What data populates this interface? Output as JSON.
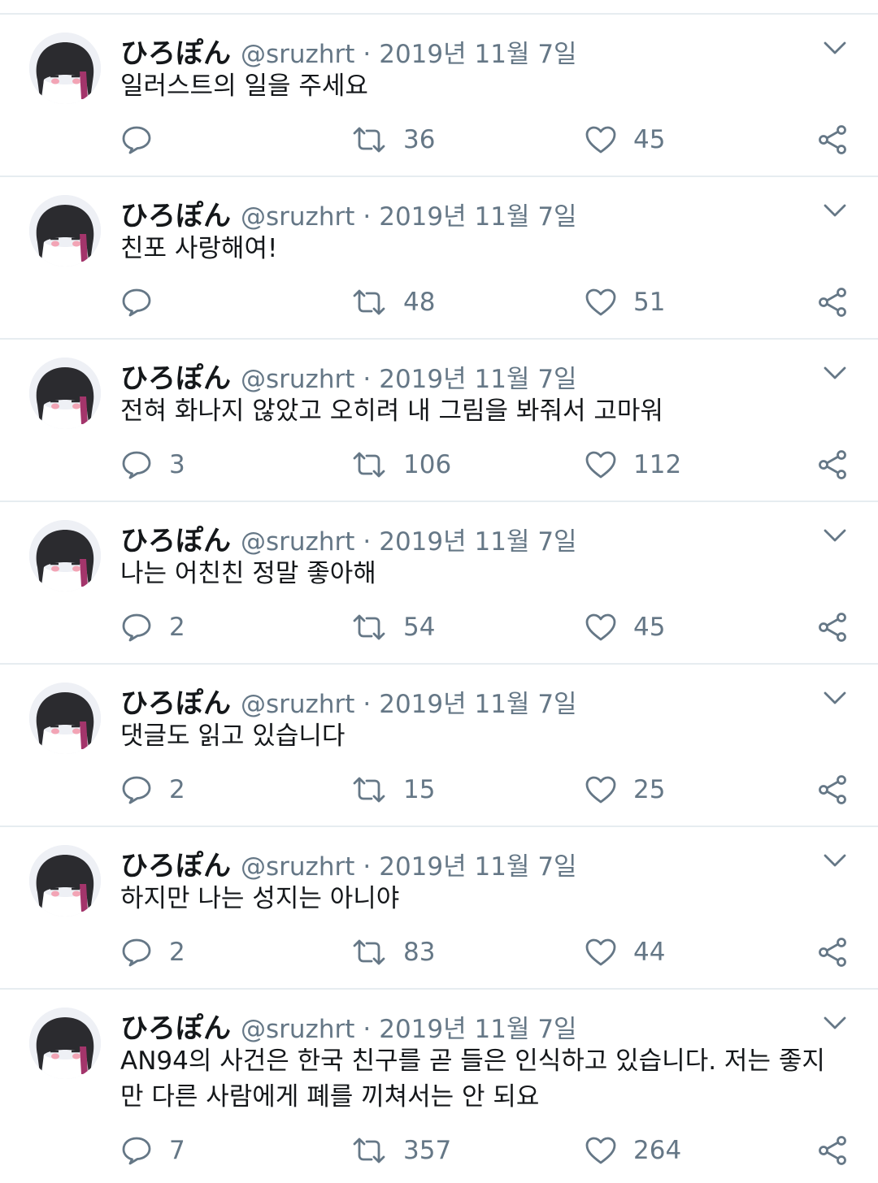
{
  "tweets": [
    {
      "name": "ひろぽん",
      "handle": "@sruzhrt",
      "sep": "·",
      "date": "2019년 11월 7일",
      "text": "일러스트의 일을 주세요",
      "replies": "",
      "retweets": "36",
      "likes": "45"
    },
    {
      "name": "ひろぽん",
      "handle": "@sruzhrt",
      "sep": "·",
      "date": "2019년 11월 7일",
      "text": "친포 사랑해여!",
      "replies": "",
      "retweets": "48",
      "likes": "51"
    },
    {
      "name": "ひろぽん",
      "handle": "@sruzhrt",
      "sep": "·",
      "date": "2019년 11월 7일",
      "text": "전혀 화나지 않았고 오히려 내 그림을 봐줘서 고마워",
      "replies": "3",
      "retweets": "106",
      "likes": "112"
    },
    {
      "name": "ひろぽん",
      "handle": "@sruzhrt",
      "sep": "·",
      "date": "2019년 11월 7일",
      "text": "나는 어친친 정말 좋아해",
      "replies": "2",
      "retweets": "54",
      "likes": "45"
    },
    {
      "name": "ひろぽん",
      "handle": "@sruzhrt",
      "sep": "·",
      "date": "2019년 11월 7일",
      "text": "댓글도 읽고 있습니다",
      "replies": "2",
      "retweets": "15",
      "likes": "25"
    },
    {
      "name": "ひろぽん",
      "handle": "@sruzhrt",
      "sep": "·",
      "date": "2019년 11월 7일",
      "text": "하지만 나는 성지는 아니야",
      "replies": "2",
      "retweets": "83",
      "likes": "44"
    },
    {
      "name": "ひろぽん",
      "handle": "@sruzhrt",
      "sep": "·",
      "date": "2019년 11월 7일",
      "text": "AN94의 사건은 한국 친구를 곧 들은 인식하고 있습니다. 저는 좋지만 다른 사람에게 폐를 끼쳐서는 안 되요",
      "replies": "7",
      "retweets": "357",
      "likes": "264"
    }
  ],
  "icons": {
    "avatar": "avatar-image",
    "menu": "chevron-down-icon",
    "reply": "reply-icon",
    "retweet": "retweet-icon",
    "like": "heart-icon",
    "share": "share-icon"
  },
  "colors": {
    "icon": "#657786",
    "divider": "#e6ecf0",
    "text": "#14171a"
  }
}
